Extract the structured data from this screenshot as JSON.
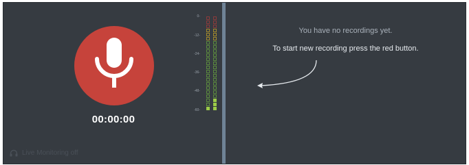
{
  "recorder": {
    "timer": "00:00:00",
    "live_monitoring_label": "Live Monitoring off",
    "record_button_icon": "microphone-icon",
    "record_button_color": "#c6433b"
  },
  "meter": {
    "scale_labels": [
      "0-",
      "-12-",
      "-24-",
      "-36-",
      "-48-",
      "-60-"
    ],
    "level_left_db": -60,
    "level_right_db": -54
  },
  "recordings": {
    "empty_message": "You have no recordings yet.",
    "hint_message": "To start new recording press the red button."
  }
}
